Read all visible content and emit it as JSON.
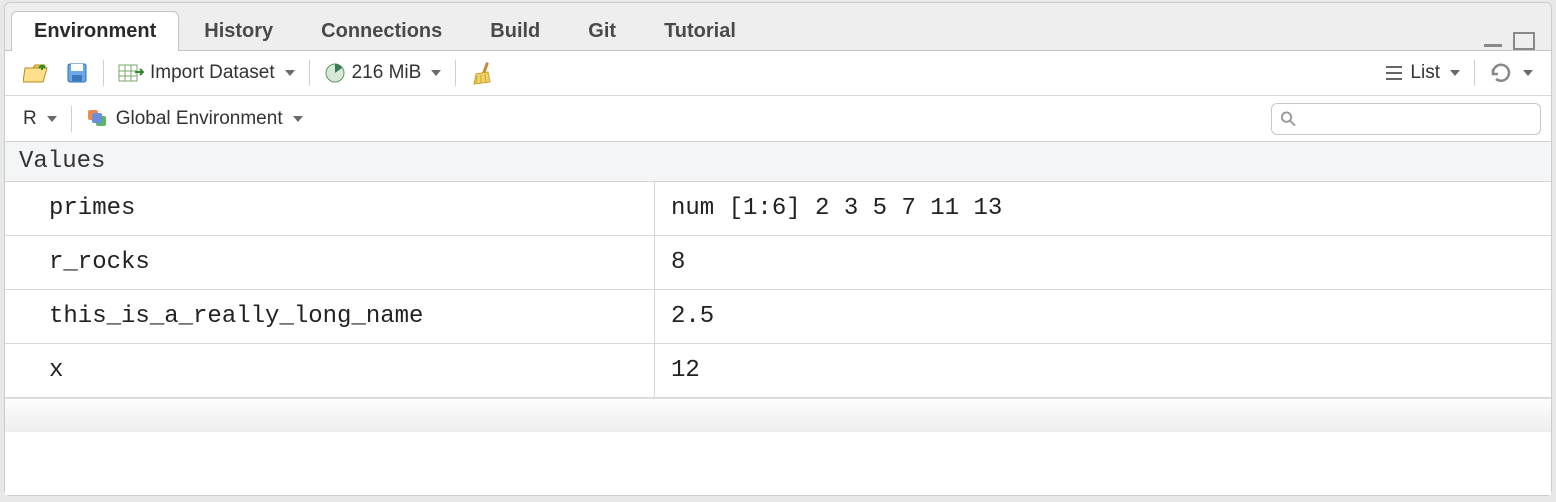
{
  "tabs": [
    {
      "label": "Environment",
      "active": true
    },
    {
      "label": "History",
      "active": false
    },
    {
      "label": "Connections",
      "active": false
    },
    {
      "label": "Build",
      "active": false
    },
    {
      "label": "Git",
      "active": false
    },
    {
      "label": "Tutorial",
      "active": false
    }
  ],
  "toolbar1": {
    "import_label": "Import Dataset",
    "memory": "216 MiB",
    "view_label": "List"
  },
  "toolbar2": {
    "lang": "R",
    "scope": "Global Environment",
    "search_placeholder": ""
  },
  "section": "Values",
  "values": [
    {
      "name": "primes",
      "value": "num [1:6] 2 3 5 7 11 13"
    },
    {
      "name": "r_rocks",
      "value": "8"
    },
    {
      "name": "this_is_a_really_long_name",
      "value": "2.5"
    },
    {
      "name": "x",
      "value": "12"
    }
  ]
}
